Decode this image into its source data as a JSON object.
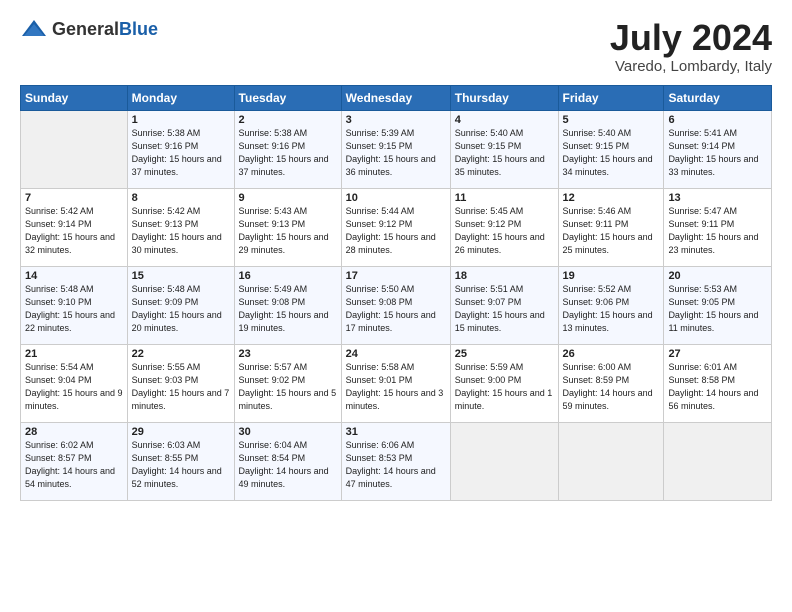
{
  "header": {
    "logo_general": "General",
    "logo_blue": "Blue",
    "month_year": "July 2024",
    "location": "Varedo, Lombardy, Italy"
  },
  "columns": [
    "Sunday",
    "Monday",
    "Tuesday",
    "Wednesday",
    "Thursday",
    "Friday",
    "Saturday"
  ],
  "weeks": [
    [
      {
        "day": "",
        "empty": true
      },
      {
        "day": "1",
        "sunrise": "5:38 AM",
        "sunset": "9:16 PM",
        "daylight": "15 hours and 37 minutes."
      },
      {
        "day": "2",
        "sunrise": "5:38 AM",
        "sunset": "9:16 PM",
        "daylight": "15 hours and 37 minutes."
      },
      {
        "day": "3",
        "sunrise": "5:39 AM",
        "sunset": "9:15 PM",
        "daylight": "15 hours and 36 minutes."
      },
      {
        "day": "4",
        "sunrise": "5:40 AM",
        "sunset": "9:15 PM",
        "daylight": "15 hours and 35 minutes."
      },
      {
        "day": "5",
        "sunrise": "5:40 AM",
        "sunset": "9:15 PM",
        "daylight": "15 hours and 34 minutes."
      },
      {
        "day": "6",
        "sunrise": "5:41 AM",
        "sunset": "9:14 PM",
        "daylight": "15 hours and 33 minutes."
      }
    ],
    [
      {
        "day": "7",
        "sunrise": "5:42 AM",
        "sunset": "9:14 PM",
        "daylight": "15 hours and 32 minutes."
      },
      {
        "day": "8",
        "sunrise": "5:42 AM",
        "sunset": "9:13 PM",
        "daylight": "15 hours and 30 minutes."
      },
      {
        "day": "9",
        "sunrise": "5:43 AM",
        "sunset": "9:13 PM",
        "daylight": "15 hours and 29 minutes."
      },
      {
        "day": "10",
        "sunrise": "5:44 AM",
        "sunset": "9:12 PM",
        "daylight": "15 hours and 28 minutes."
      },
      {
        "day": "11",
        "sunrise": "5:45 AM",
        "sunset": "9:12 PM",
        "daylight": "15 hours and 26 minutes."
      },
      {
        "day": "12",
        "sunrise": "5:46 AM",
        "sunset": "9:11 PM",
        "daylight": "15 hours and 25 minutes."
      },
      {
        "day": "13",
        "sunrise": "5:47 AM",
        "sunset": "9:11 PM",
        "daylight": "15 hours and 23 minutes."
      }
    ],
    [
      {
        "day": "14",
        "sunrise": "5:48 AM",
        "sunset": "9:10 PM",
        "daylight": "15 hours and 22 minutes."
      },
      {
        "day": "15",
        "sunrise": "5:48 AM",
        "sunset": "9:09 PM",
        "daylight": "15 hours and 20 minutes."
      },
      {
        "day": "16",
        "sunrise": "5:49 AM",
        "sunset": "9:08 PM",
        "daylight": "15 hours and 19 minutes."
      },
      {
        "day": "17",
        "sunrise": "5:50 AM",
        "sunset": "9:08 PM",
        "daylight": "15 hours and 17 minutes."
      },
      {
        "day": "18",
        "sunrise": "5:51 AM",
        "sunset": "9:07 PM",
        "daylight": "15 hours and 15 minutes."
      },
      {
        "day": "19",
        "sunrise": "5:52 AM",
        "sunset": "9:06 PM",
        "daylight": "15 hours and 13 minutes."
      },
      {
        "day": "20",
        "sunrise": "5:53 AM",
        "sunset": "9:05 PM",
        "daylight": "15 hours and 11 minutes."
      }
    ],
    [
      {
        "day": "21",
        "sunrise": "5:54 AM",
        "sunset": "9:04 PM",
        "daylight": "15 hours and 9 minutes."
      },
      {
        "day": "22",
        "sunrise": "5:55 AM",
        "sunset": "9:03 PM",
        "daylight": "15 hours and 7 minutes."
      },
      {
        "day": "23",
        "sunrise": "5:57 AM",
        "sunset": "9:02 PM",
        "daylight": "15 hours and 5 minutes."
      },
      {
        "day": "24",
        "sunrise": "5:58 AM",
        "sunset": "9:01 PM",
        "daylight": "15 hours and 3 minutes."
      },
      {
        "day": "25",
        "sunrise": "5:59 AM",
        "sunset": "9:00 PM",
        "daylight": "15 hours and 1 minute."
      },
      {
        "day": "26",
        "sunrise": "6:00 AM",
        "sunset": "8:59 PM",
        "daylight": "14 hours and 59 minutes."
      },
      {
        "day": "27",
        "sunrise": "6:01 AM",
        "sunset": "8:58 PM",
        "daylight": "14 hours and 56 minutes."
      }
    ],
    [
      {
        "day": "28",
        "sunrise": "6:02 AM",
        "sunset": "8:57 PM",
        "daylight": "14 hours and 54 minutes."
      },
      {
        "day": "29",
        "sunrise": "6:03 AM",
        "sunset": "8:55 PM",
        "daylight": "14 hours and 52 minutes."
      },
      {
        "day": "30",
        "sunrise": "6:04 AM",
        "sunset": "8:54 PM",
        "daylight": "14 hours and 49 minutes."
      },
      {
        "day": "31",
        "sunrise": "6:06 AM",
        "sunset": "8:53 PM",
        "daylight": "14 hours and 47 minutes."
      },
      {
        "day": "",
        "empty": true
      },
      {
        "day": "",
        "empty": true
      },
      {
        "day": "",
        "empty": true
      }
    ]
  ]
}
